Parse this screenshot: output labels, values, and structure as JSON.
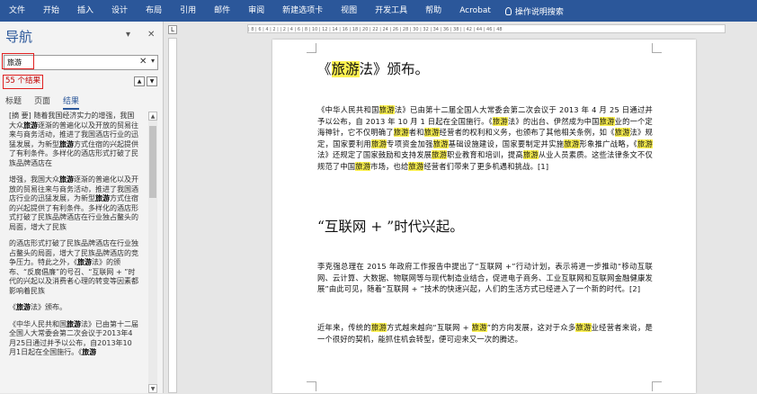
{
  "ribbon": {
    "tabs": [
      "文件",
      "开始",
      "插入",
      "设计",
      "布局",
      "引用",
      "邮件",
      "审阅",
      "新建选项卡",
      "视图",
      "开发工具",
      "帮助",
      "Acrobat"
    ],
    "search_label": "操作说明搜索"
  },
  "nav": {
    "title": "导航",
    "search_value": "旅游",
    "results_count": "55 个结果",
    "tabs": [
      "标题",
      "页面",
      "结果"
    ],
    "results": [
      "[摘 要] 随着我国经济实力的增强，我国大众旅游逐渐的普遍化以及开放的贸易往来与商务活动，推进了我国酒店行业的迅猛发展，为新型旅游方式住宿的兴起提供了有利条件。多样化的酒店形式打破了民族品牌酒店在",
      "增强，我国大众旅游逐渐的普遍化以及开放的贸易往来与商务活动，推进了我国酒店行业的迅猛发展，为新型旅游方式住宿的兴起提供了有利条件。多样化的酒店形式打破了民族品牌酒店在行业独占鳌头的局面，增大了民族",
      "的酒店形式打破了民族品牌酒店在行业独占鳌头的局面，增大了民族品牌酒店的竞争压力。特此之外，《旅游法》的颁布、“反腐倡廉”的号召、“互联网 + ”时代的兴起以及消费者心理的转变等因素都影响着民族",
      "《旅游法》颁布。",
      "《中华人民共和国旅游法》已由第十二届全国人大常委会第二次会议于2013年4月25日通过并予以公布，自2013年10月1日起在全国施行。《旅游"
    ]
  },
  "ruler": {
    "ticks": "| 8 | 6 | 4 | 2 |    | 2 | 4 | 6 | 8 | 10 | 12 | 14 | 16 | 18 | 20 | 22 | 24 | 26 | 28 | 30 | 32 | 34 | 36 | 38 |    | 42 | 44 | 46 | 48"
  },
  "doc": {
    "h1": "《旅游法》颁布。",
    "p1": "《中华人民共和国旅游法》已由第十二届全国人大常委会第二次会议于 2013 年 4 月 25 日通过并予以公布，自 2013 年 10 月 1 日起在全国施行。《旅游法》的出台、伊然成为中国旅游业的一个定海神针，它不仅明确了旅游者和旅游经营者的权利和义务，也颁布了其他相关条例，如《旅游法》规定，国家要利用旅游专项资金加强旅游基础设施建设，国家要制定并实施旅游形象推广战略，《旅游法》还规定了国家鼓励和支持发展旅游职业教育和培训，提高旅游从业人员素质。这些法律条文不仅规范了中国旅游市场，也给旅游经营者们带来了更多机遇和挑战。[1]",
    "h2": "“互联网 + ”时代兴起。",
    "p2": "李克强总理在 2015 年政府工作报告中提出了“互联网 +”行动计划，表示将进一步推动“移动互联网、云计算、大数据、物联网等与现代制造业结合，促进电子商务、工业互联网和互联网金融健康发展”由此可见，随着“互联网 + ”技术的快速兴起，人们的生活方式已经进入了一个新的时代。[2]",
    "p3": "近年来，传统的旅游方式越来越向“互联网 + 旅游”的方向发展，这对于众多旅游业经营者来说，是一个很好的契机，能抓住机会转型，便可迎来又一次的腾达。"
  },
  "highlight_term": "旅游",
  "colors": {
    "ribbon": "#2b579a",
    "highlight": "#fdf250",
    "callout": "#e02020"
  }
}
